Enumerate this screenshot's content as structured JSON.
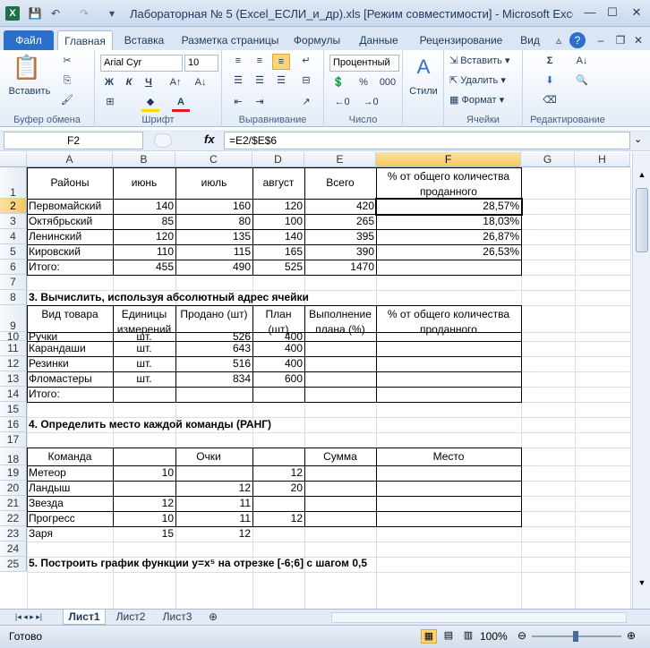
{
  "window": {
    "title": "Лабораторная № 5 (Excel_ЕСЛИ_и_др).xls  [Режим совместимости]  -  Microsoft Excel",
    "app_icon": "X",
    "qat": {
      "save": "💾",
      "undo": "↶",
      "redo": "↷",
      "more": "▾"
    },
    "min": "—",
    "max": "☐",
    "close": "✕"
  },
  "ribbon_tabs": [
    "Файл",
    "Главная",
    "Вставка",
    "Разметка страницы",
    "Формулы",
    "Данные",
    "Рецензирование",
    "Вид"
  ],
  "ribbon": {
    "paste_label": "Вставить",
    "clipboard_label": "Буфер обмена",
    "font_name": "Arial Cyr",
    "font_size": "10",
    "font_group_label": "Шрифт",
    "bold": "Ж",
    "italic": "К",
    "underline": "Ч",
    "align_label": "Выравнивание",
    "number_format": "Процентный",
    "number_label": "Число",
    "percent": "%",
    "thousands": "000",
    "styles_label": "Стили",
    "cells_insert": "Вставить",
    "cells_delete": "Удалить",
    "cells_format": "Формат",
    "cells_label": "Ячейки",
    "editing_label": "Редактирование"
  },
  "formula_bar": {
    "cell_ref": "F2",
    "fx": "fx",
    "formula": "=E2/$E$6"
  },
  "columns": [
    "A",
    "B",
    "C",
    "D",
    "E",
    "F",
    "G",
    "H"
  ],
  "rows": [
    "1",
    "2",
    "3",
    "4",
    "5",
    "6",
    "7",
    "8",
    "9",
    "10",
    "11",
    "12",
    "13",
    "14",
    "15",
    "16",
    "17",
    "18",
    "19",
    "20",
    "21",
    "22",
    "23",
    "24",
    "25"
  ],
  "table1": {
    "headers": [
      "Районы",
      "июнь",
      "июль",
      "август",
      "Всего",
      "% от общего количества проданного"
    ],
    "rows": [
      [
        "Первомайский",
        "140",
        "160",
        "120",
        "420",
        "28,57%"
      ],
      [
        "Октябрьский",
        "85",
        "80",
        "100",
        "265",
        "18,03%"
      ],
      [
        "Ленинский",
        "120",
        "135",
        "140",
        "395",
        "26,87%"
      ],
      [
        "Кировский",
        "110",
        "115",
        "165",
        "390",
        "26,53%"
      ],
      [
        "Итого:",
        "455",
        "490",
        "525",
        "1470",
        ""
      ]
    ]
  },
  "section3": {
    "title": "3. Вычислить, используя абсолютный адрес ячейки",
    "headers": [
      "Вид товара",
      "Единицы измерений",
      "Продано (шт)",
      "План (шт)",
      "Выполнение плана (%)",
      "% от общего количества проданного"
    ],
    "rows": [
      [
        "Ручки",
        "шт.",
        "526",
        "400",
        "",
        ""
      ],
      [
        "Карандаши",
        "шт.",
        "643",
        "400",
        "",
        ""
      ],
      [
        "Резинки",
        "шт.",
        "516",
        "400",
        "",
        ""
      ],
      [
        "Фломастеры",
        "шт.",
        "834",
        "600",
        "",
        ""
      ],
      [
        "Итого:",
        "",
        "",
        "",
        "",
        ""
      ]
    ]
  },
  "section4": {
    "title": "4. Определить место каждой команды (РАНГ)",
    "headers": [
      "Команда",
      "Очки",
      "Сумма",
      "Место"
    ],
    "rows": [
      [
        "Метеор",
        "10",
        "",
        "12",
        "",
        ""
      ],
      [
        "Ландыш",
        "",
        "12",
        "20",
        "",
        ""
      ],
      [
        "Звезда",
        "12",
        "11",
        "",
        "",
        ""
      ],
      [
        "Прогресс",
        "10",
        "11",
        "12",
        "",
        ""
      ],
      [
        "Заря",
        "15",
        "12",
        "",
        "",
        ""
      ]
    ]
  },
  "section5_title": "5. Построить график функции y=x⁵ на отрезке [-6;6] с шагом 0,5",
  "sheets": [
    "Лист1",
    "Лист2",
    "Лист3"
  ],
  "status": {
    "ready": "Готово",
    "zoom": "100%"
  }
}
